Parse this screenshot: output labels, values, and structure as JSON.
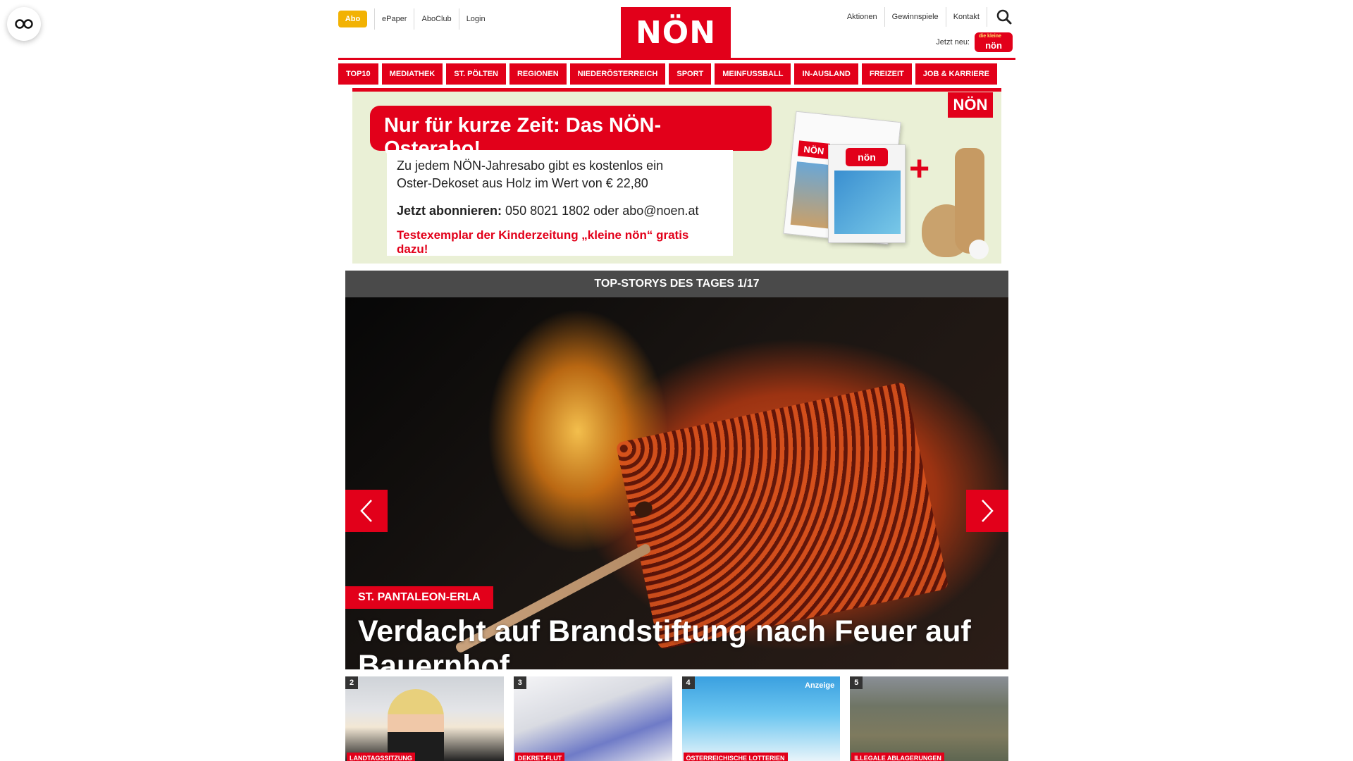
{
  "header": {
    "abo_label": "Abo",
    "links_left": [
      "ePaper",
      "AboClub",
      "Login"
    ],
    "logo_text": "NÖN",
    "links_right": [
      "Aktionen",
      "Gewinnspiele",
      "Kontakt"
    ],
    "jetzt_neu": "Jetzt neu:",
    "kleine_logo_top": "die kleine",
    "kleine_logo": "nön"
  },
  "nav": [
    "TOP10",
    "MEDIATHEK",
    "ST. PÖLTEN",
    "REGIONEN",
    "NIEDERÖSTERREICH",
    "SPORT",
    "MEINFUSSBALL",
    "IN-AUSLAND",
    "FREIZEIT",
    "JOB & KARRIERE"
  ],
  "ad": {
    "headline": "Nur für kurze Zeit: Das NÖN-Osterabo!",
    "body": "Zu jedem NÖN-Jahresabo gibt es kostenlos ein Oster-Dekoset aus Holz im Wert von € 22,80",
    "contact_label": "Jetzt abonnieren:",
    "contact_value": "050 8021 1802 oder abo@noen.at",
    "red_line": "Testexemplar der Kinderzeitung „kleine nön“ gratis dazu!",
    "logo": "NÖN",
    "paper_logo": "NÖN",
    "kids_logo": "nön",
    "plus": "+"
  },
  "topstory": {
    "header": "TOP-STORYS DES TAGES 1/17",
    "tag": "ST. PANTALEON-ERLA",
    "title": "Verdacht auf Brandstiftung nach Feuer auf Bauernhof"
  },
  "teasers": [
    {
      "num": "2",
      "tag": "LANDTAGSSITZUNG"
    },
    {
      "num": "3",
      "tag": "DEKRET-FLUT"
    },
    {
      "num": "4",
      "tag": "ÖSTERREICHISCHE LOTTERIEN",
      "anzeige": "Anzeige"
    },
    {
      "num": "5",
      "tag": "ILLEGALE ABLAGERUNGEN"
    }
  ],
  "colors": {
    "brand_red": "#e2001a",
    "abo_yellow": "#f2b203"
  },
  "icons": [
    "glasses-icon",
    "search-icon",
    "chevron-left-icon",
    "chevron-right-icon"
  ]
}
